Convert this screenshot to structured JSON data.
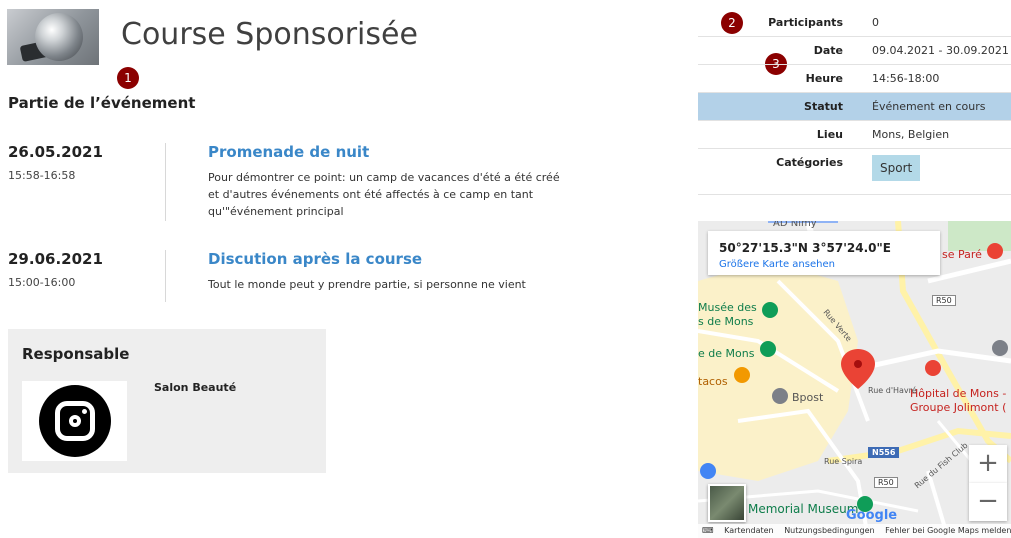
{
  "header": {
    "title": "Course Sponsorisée"
  },
  "markers": [
    "1",
    "2",
    "3"
  ],
  "section_title": "Partie de l’événement",
  "events": [
    {
      "date": "26.05.2021",
      "time": "15:58-16:58",
      "name": "Promenade de nuit",
      "description": "Pour démontrer ce point: un camp de vacances d'été a été créé et d'autres événements ont été affectés à ce camp en tant qu'\"événement principal"
    },
    {
      "date": "29.06.2021",
      "time": "15:00-16:00",
      "name": "Discution après la course",
      "description": "Tout le monde peut y prendre partie, si personne ne vient"
    }
  ],
  "responsible": {
    "title": "Responsable",
    "name": "Salon Beauté"
  },
  "info": {
    "participants": {
      "label": "Participants",
      "value": "0"
    },
    "date": {
      "label": "Date",
      "value": "09.04.2021 - 30.09.2021"
    },
    "time": {
      "label": "Heure",
      "value": "14:56-18:00"
    },
    "status": {
      "label": "Statut",
      "value": "Événement en cours"
    },
    "location": {
      "label": "Lieu",
      "value": "Mons, Belgien"
    },
    "categories": {
      "label": "Catégories",
      "tag": "Sport"
    }
  },
  "map": {
    "coords": "50°27'15.3\"N 3°57'24.0\"E",
    "larger_map_link": "Größere Karte ansehen",
    "poi": {
      "musee": "Musée des",
      "musee2": "s de Mons",
      "mons": "e de Mons",
      "tacos": "tacos",
      "bpost": "Bpost",
      "hopital1": "Hôpital de Mons -",
      "hopital2": "Groupe Jolimont (",
      "memorial": "Memorial Museum",
      "pare": "se Paré",
      "top": "AD Nimy"
    },
    "roads": {
      "verte": "Rue Verte",
      "havre": "Rue d'Havré",
      "spira": "Rue Spira",
      "club": "Rue du Fish Club",
      "r50a": "R50",
      "r50b": "R50",
      "n556": "N556"
    },
    "google": "Google",
    "zoom_in": "+",
    "zoom_out": "−",
    "footer": [
      "Kartendaten",
      "Nutzungsbedingungen",
      "Fehler bei Google Maps melden"
    ],
    "colors": {
      "pin": "#ea4335",
      "poi_green": "#0f7d4b",
      "poi_red": "#c5221f"
    }
  },
  "colors": {
    "link": "#3a87c8",
    "marker": "#8b0000",
    "status_bg": "#b3d1e8"
  }
}
